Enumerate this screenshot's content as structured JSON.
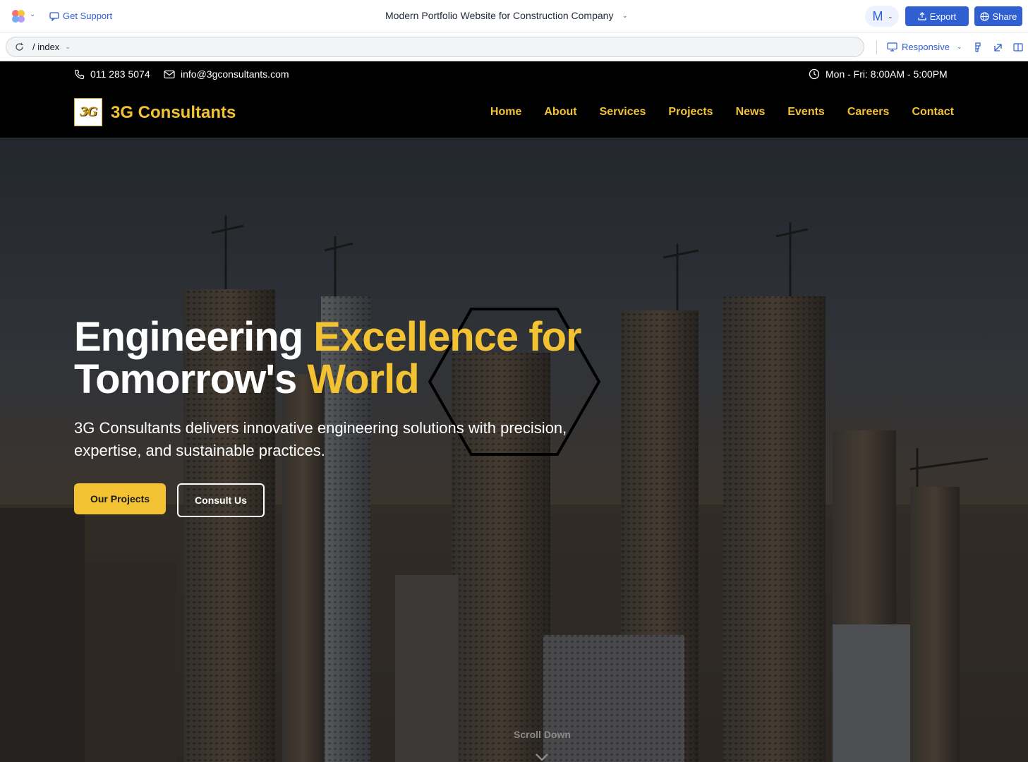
{
  "app": {
    "support_label": "Get Support",
    "doc_title": "Modern Portfolio Website for Construction Company",
    "avatar_initial": "M",
    "export_label": "Export",
    "share_label": "Share",
    "brand_color": "#2f5fd0"
  },
  "address": {
    "path": "/ index",
    "viewport_label": "Responsive"
  },
  "site": {
    "topbar": {
      "phone": "011 283 5074",
      "email": "info@3gconsultants.com",
      "hours": "Mon - Fri: 8:00AM - 5:00PM"
    },
    "brand": {
      "logo_text": "3G",
      "name": "3G Consultants"
    },
    "nav": [
      "Home",
      "About",
      "Services",
      "Projects",
      "News",
      "Events",
      "Careers",
      "Contact"
    ],
    "hero": {
      "title_white_1": "Engineering ",
      "title_accent_1": "Excellence for",
      "title_white_2": "Tomorrow's ",
      "title_accent_2": "World",
      "subtitle": "3G Consultants delivers innovative engineering solutions with precision, expertise, and sustainable practices.",
      "primary_button": "Our Projects",
      "secondary_button": "Consult Us",
      "scroll_label": "Scroll Down"
    },
    "accent_color": "#f2c232"
  }
}
